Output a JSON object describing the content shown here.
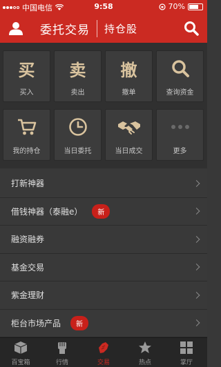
{
  "status_bar": {
    "carrier": "中国电信",
    "time": "9:58",
    "battery_text": "70%",
    "battery_level": 0.7
  },
  "header": {
    "title": "委托交易",
    "subtitle": "持仓股"
  },
  "grid": [
    {
      "name": "buy",
      "icon_text": "买",
      "label": "买入"
    },
    {
      "name": "sell",
      "icon_text": "卖",
      "label": "卖出"
    },
    {
      "name": "cancel",
      "icon_text": "撤",
      "label": "撤单"
    },
    {
      "name": "query-funds",
      "icon": "search-icon",
      "label": "查询资金"
    },
    {
      "name": "holdings",
      "icon": "cart-icon",
      "label": "我的持仓"
    },
    {
      "name": "today-orders",
      "icon": "clock-icon",
      "label": "当日委托"
    },
    {
      "name": "today-deals",
      "icon": "handshake-icon",
      "label": "当日成交"
    },
    {
      "name": "more",
      "icon": "ellipsis-icon",
      "label": "更多"
    }
  ],
  "menu": [
    {
      "label": "打新神器",
      "badge": ""
    },
    {
      "label": "借钱神器（泰融e）",
      "badge": "新"
    },
    {
      "label": "融资融券",
      "badge": ""
    },
    {
      "label": "基金交易",
      "badge": ""
    },
    {
      "label": "紫金理财",
      "badge": ""
    },
    {
      "label": "柜台市场产品",
      "badge": "新"
    }
  ],
  "tabs": [
    {
      "label": "百宝箱",
      "icon": "box-icon",
      "active": false
    },
    {
      "label": "行情",
      "icon": "fist-icon",
      "active": false
    },
    {
      "label": "交易",
      "icon": "trade-icon",
      "active": true
    },
    {
      "label": "热点",
      "icon": "star-icon",
      "active": false
    },
    {
      "label": "掌厅",
      "icon": "grid-icon",
      "active": false
    }
  ],
  "colors": {
    "brand_red": "#cb2a22",
    "gold": "#d9c39e",
    "background": "#383838"
  }
}
